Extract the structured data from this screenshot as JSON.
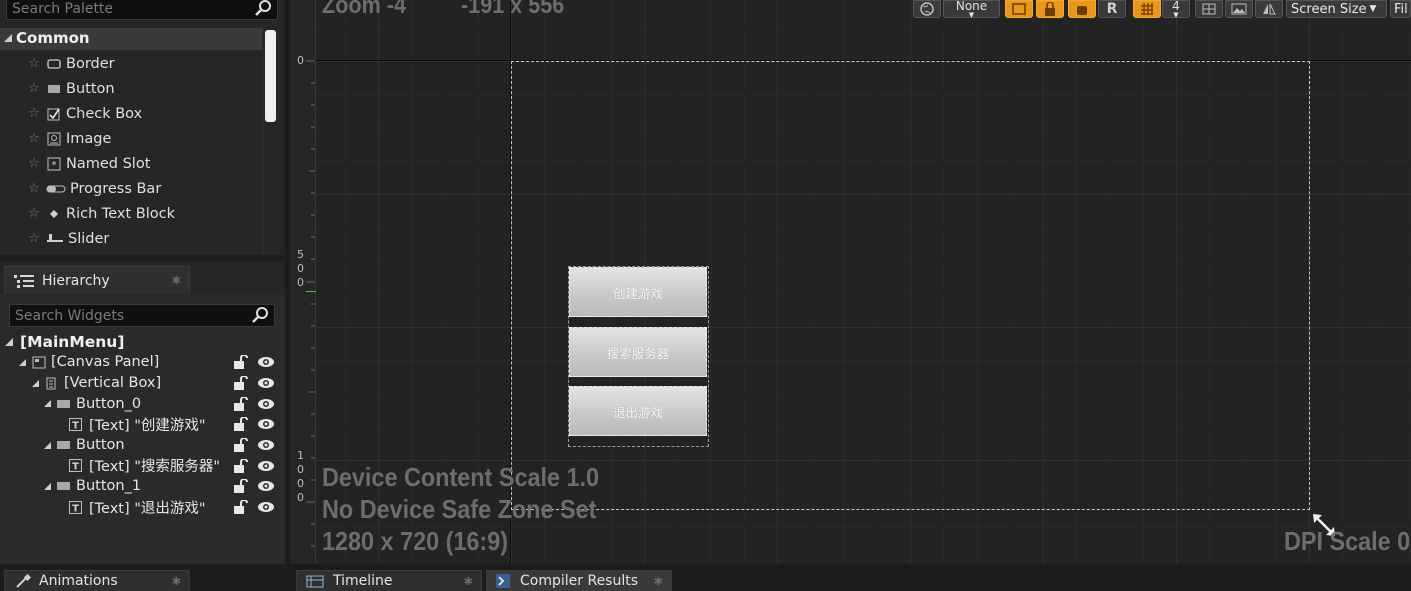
{
  "palette": {
    "search_placeholder": "Search Palette",
    "category": "Common",
    "items": [
      {
        "label": "Border",
        "icon": "border-icon"
      },
      {
        "label": "Button",
        "icon": "button-icon"
      },
      {
        "label": "Check Box",
        "icon": "checkbox-icon"
      },
      {
        "label": "Image",
        "icon": "image-icon"
      },
      {
        "label": "Named Slot",
        "icon": "named-slot-icon"
      },
      {
        "label": "Progress Bar",
        "icon": "progress-bar-icon"
      },
      {
        "label": "Rich Text Block",
        "icon": "rich-text-icon"
      },
      {
        "label": "Slider",
        "icon": "slider-icon"
      }
    ]
  },
  "hierarchy": {
    "tab_label": "Hierarchy",
    "search_placeholder": "Search Widgets",
    "root": "[MainMenu]",
    "rows": [
      {
        "label": "[Canvas Panel]"
      },
      {
        "label": "[Vertical Box]"
      },
      {
        "label": "Button_0"
      },
      {
        "label": "[Text] \"创建游戏\""
      },
      {
        "label": "Button"
      },
      {
        "label": "[Text] \"搜索服务器\""
      },
      {
        "label": "Button_1"
      },
      {
        "label": "[Text] \"退出游戏\""
      }
    ]
  },
  "designer": {
    "zoom": "Zoom -4",
    "cursor": "-191 x 556",
    "toolbar": {
      "none_label": "None",
      "r_label": "R",
      "grid_snap": "4",
      "screen_size": "Screen Size",
      "fill": "Fil"
    },
    "ruler_marks": [
      "0",
      "5",
      "0",
      "0",
      "1",
      "0",
      "0",
      "0"
    ],
    "buttons": [
      "创建游戏",
      "搜索服务器",
      "退出游戏"
    ],
    "info": [
      "Device Content Scale 1.0",
      "No Device Safe Zone Set",
      "1280 x 720 (16:9)"
    ],
    "dpi": "DPI Scale 0."
  },
  "bottom_tabs": {
    "animations": "Animations",
    "timeline": "Timeline",
    "compiler": "Compiler Results"
  },
  "colors": {
    "accent_orange": "#e8961c",
    "ruler_marker": "#3cc83c"
  }
}
